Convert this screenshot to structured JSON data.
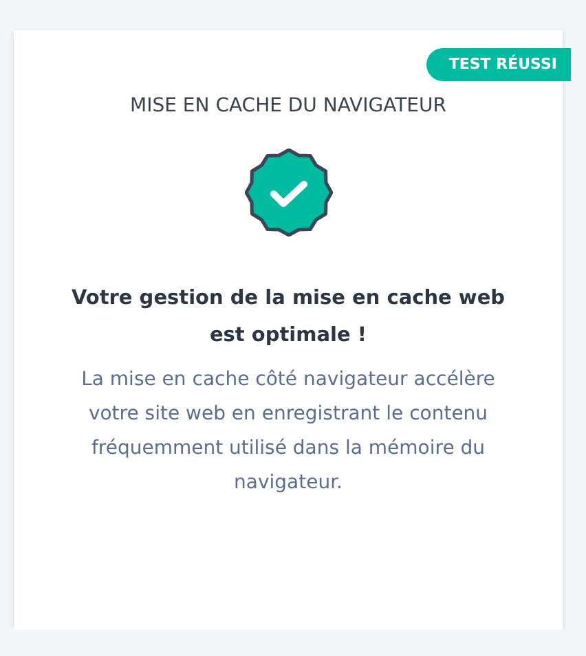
{
  "card": {
    "badge": "TEST RÉUSSI",
    "passed": true,
    "title": "MISE EN CACHE DU NAVIGATEUR",
    "heading": "Votre gestion de la mise en cache web est optimale !",
    "description": "La mise en cache côté navigateur accélère votre site web en enregistrant le contenu fréquemment utilisé dans la mémoire du navigateur."
  }
}
